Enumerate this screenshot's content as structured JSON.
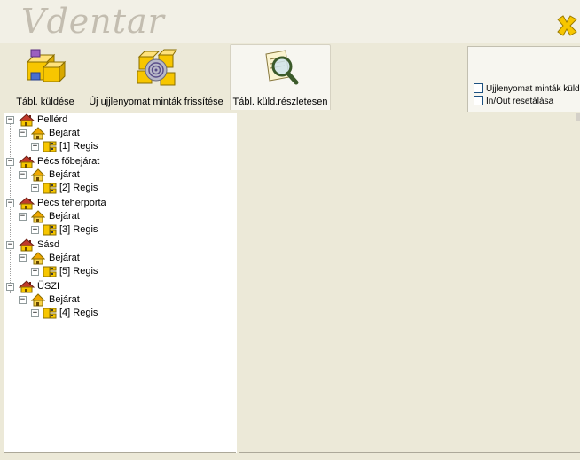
{
  "app": {
    "logo_text": "Vdentar"
  },
  "toolbar": {
    "send_label": "Tábl. küldése",
    "refresh_label": "Új ujjlenyomat minták frissítése",
    "details_label": "Tábl. küld.részletesen"
  },
  "options": {
    "opt1_label": "Ujjlenyomat minták küld",
    "opt2_label": "In/Out resetálása"
  },
  "tree": {
    "sites": [
      {
        "name": "Pellérd",
        "entrance": "Bejárat",
        "device": "[1] Regis"
      },
      {
        "name": "Pécs főbejárat",
        "entrance": "Bejárat",
        "device": "[2] Regis"
      },
      {
        "name": "Pécs teherporta",
        "entrance": "Bejárat",
        "device": "[3] Regis"
      },
      {
        "name": "Sásd",
        "entrance": "Bejárat",
        "device": "[5] Regis"
      },
      {
        "name": "ÜSZI",
        "entrance": "Bejárat",
        "device": "[4] Regis"
      }
    ]
  },
  "colors": {
    "folder_yellow": "#f7c600",
    "house_roof": "#c0392b",
    "accent_blue": "#1c5180"
  }
}
